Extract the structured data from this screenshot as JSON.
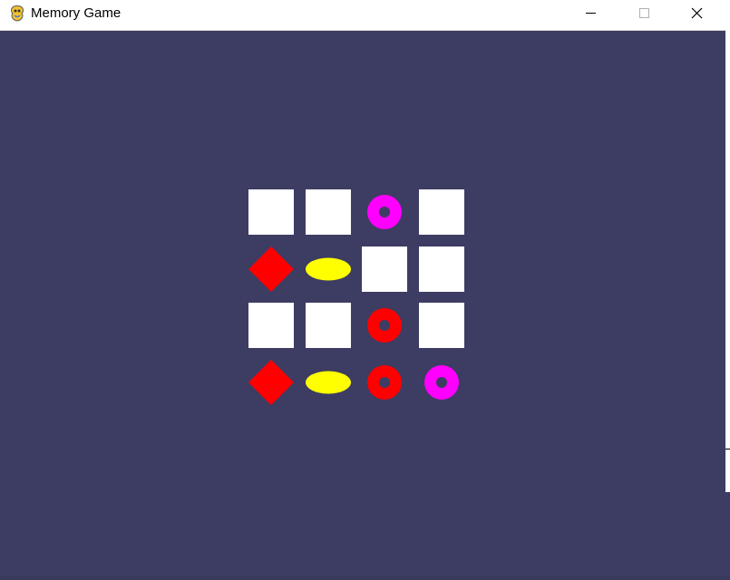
{
  "window": {
    "title": "Memory Game",
    "app_icon": "pygame-snake-icon",
    "controls": [
      "minimize-icon",
      "maximize-icon",
      "close-icon"
    ]
  },
  "game": {
    "background_color": "#3d3c62",
    "covered_color": "#ffffff",
    "rows": 4,
    "columns": 4,
    "board": [
      [
        {
          "state": "covered"
        },
        {
          "state": "covered"
        },
        {
          "state": "revealed",
          "shape": "donut",
          "color": "#ff00ff"
        },
        {
          "state": "covered"
        }
      ],
      [
        {
          "state": "revealed",
          "shape": "diamond",
          "color": "#ff0000"
        },
        {
          "state": "revealed",
          "shape": "oval",
          "color": "#ffff00"
        },
        {
          "state": "covered"
        },
        {
          "state": "covered"
        }
      ],
      [
        {
          "state": "covered"
        },
        {
          "state": "covered"
        },
        {
          "state": "revealed",
          "shape": "donut",
          "color": "#ff0000"
        },
        {
          "state": "covered"
        }
      ],
      [
        {
          "state": "revealed",
          "shape": "diamond",
          "color": "#ff0000"
        },
        {
          "state": "revealed",
          "shape": "oval",
          "color": "#ffff00"
        },
        {
          "state": "revealed",
          "shape": "donut",
          "color": "#ff0000"
        },
        {
          "state": "revealed",
          "shape": "donut",
          "color": "#ff00ff"
        }
      ]
    ]
  }
}
